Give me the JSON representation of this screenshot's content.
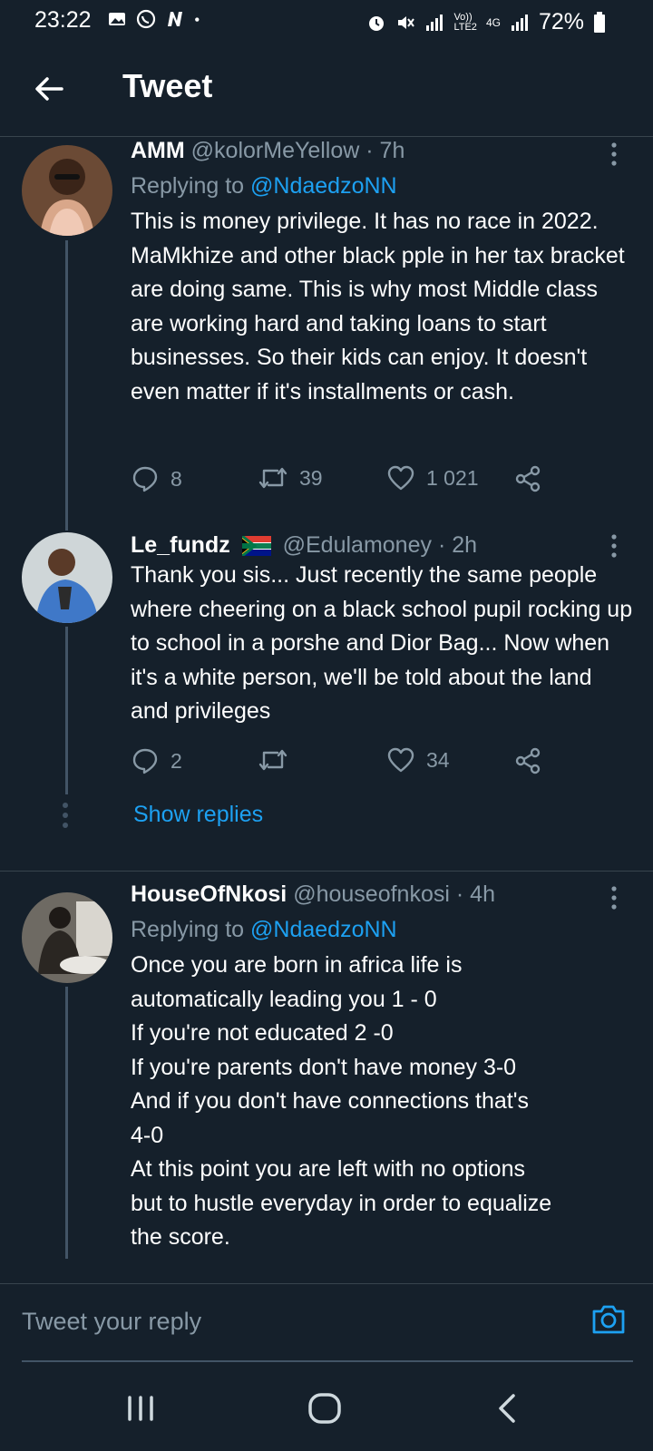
{
  "status_bar": {
    "time": "23:22",
    "network_top": "Vo))",
    "network_bottom": "LTE2",
    "network_type": "4G",
    "battery": "72%"
  },
  "header": {
    "title": "Tweet"
  },
  "tweets": [
    {
      "name": "AMM",
      "handle": "@kolorMeYellow",
      "time": "· 7h",
      "replying_prefix": "Replying to",
      "replying_to": "@NdaedzoNN",
      "text": "This is money privilege. It has no race in 2022. MaMkhize and other black pple in her tax bracket are doing same. This is why most Middle class are working hard and taking loans to start businesses. So their kids can enjoy. It doesn't even matter if it's installments or cash.",
      "replies": "8",
      "retweets": "39",
      "likes": "1 021"
    },
    {
      "name": "Le_fundz",
      "handle": "@Edulamoney",
      "time": "· 2h",
      "text": "Thank you sis... Just recently the same people where cheering on a black school pupil rocking up to school in a porshe and Dior Bag... Now when it's a white person, we'll be told about the land and privileges",
      "replies": "2",
      "retweets": "",
      "likes": "34"
    },
    {
      "name": "HouseOfNkosi",
      "handle": "@houseofnkosi",
      "time": "· 4h",
      "replying_prefix": "Replying to",
      "replying_to": "@NdaedzoNN",
      "text": "Once you are born in africa life is\nautomatically leading you 1 - 0\nIf you're not educated 2 -0\nIf you're parents don't have money  3-0\nAnd if you don't have connections that's\n4-0\nAt this point you are left with no options\nbut to hustle everyday in order to equalize\nthe score."
    }
  ],
  "show_replies": "Show replies",
  "reply_bar": {
    "placeholder": "Tweet your reply"
  },
  "colors": {
    "background": "#15202b",
    "accent": "#1da1f2",
    "muted": "#8899a6"
  }
}
